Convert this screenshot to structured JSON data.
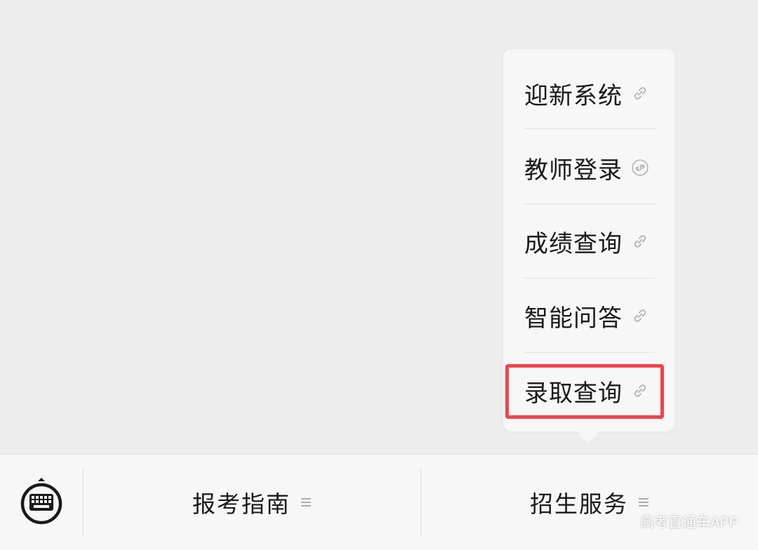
{
  "popup_menu": {
    "items": [
      {
        "label": "迎新系统",
        "icon": "link-icon"
      },
      {
        "label": "教师登录",
        "icon": "mini-program-icon"
      },
      {
        "label": "成绩查询",
        "icon": "link-icon"
      },
      {
        "label": "智能问答",
        "icon": "link-icon"
      },
      {
        "label": "录取查询",
        "icon": "link-icon",
        "highlighted": true
      }
    ],
    "highlight_color": "#f0444a"
  },
  "bottom_bar": {
    "keyboard_icon": "keyboard-icon",
    "tabs": [
      {
        "label": "报考指南",
        "icon": "menu-lines-icon"
      },
      {
        "label": "招生服务",
        "icon": "menu-lines-icon"
      }
    ]
  },
  "watermark": {
    "text": "高考直通车APP"
  }
}
